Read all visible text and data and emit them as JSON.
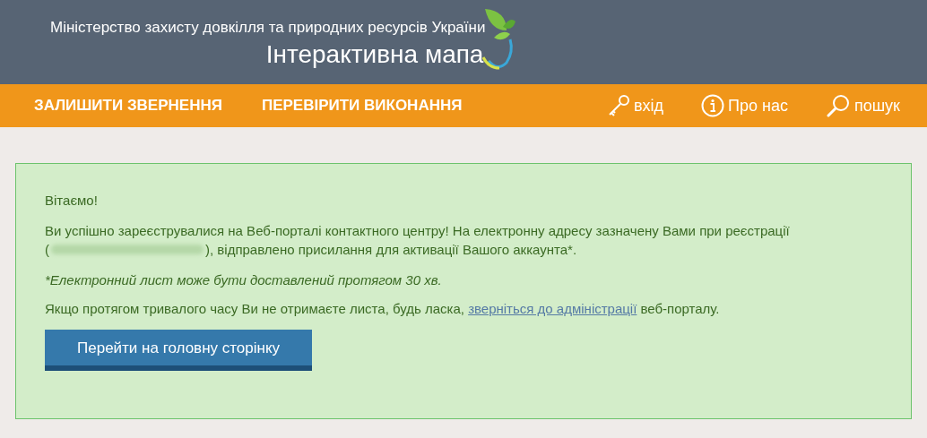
{
  "header": {
    "ministry": "Міністерство захисту довкілля та природних ресурсів України",
    "title": "Інтерактивна мапа"
  },
  "nav": {
    "left": [
      "ЗАЛИШИТИ ЗВЕРНЕННЯ",
      "ПЕРЕВІРИТИ ВИКОНАННЯ"
    ],
    "right": [
      {
        "kind": "key",
        "label": "вхід"
      },
      {
        "kind": "info",
        "label": "Про нас"
      },
      {
        "kind": "search",
        "label": "пошук"
      }
    ]
  },
  "message": {
    "greeting": "Вітаємо!",
    "line_1": "Ви успішно зареєструвалися на Веб-порталі контактного центру! На електронну адресу зазначену Вами при реєстрації",
    "line_2_before": "(",
    "line_2_after": "), відправлено присилання для активації Вашого аккаунта*.",
    "note": "*Електронний лист може бути доставлений протягом 30 хв.",
    "help_before": "Якщо протягом тривалого часу Ви не отримаєте листа, будь ласка, ",
    "help_link": "зверніться до адміністрації",
    "help_after": " веб-порталу.",
    "button": "Перейти на головну сторінку"
  }
}
